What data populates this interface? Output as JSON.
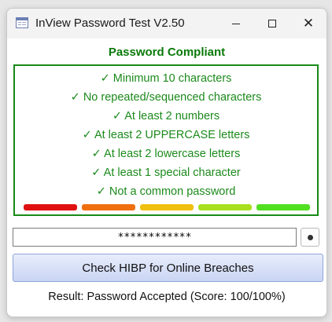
{
  "window": {
    "title": "InView Password Test V2.50",
    "controls": {
      "minimize": "minimize-icon",
      "maximize": "maximize-icon",
      "close": "close-icon"
    }
  },
  "status": {
    "heading": "Password Compliant",
    "color": "#0a7a0a"
  },
  "checks": [
    "✓ Minimum 10 characters",
    "✓ No repeated/sequenced characters",
    "✓ At least 2 numbers",
    "✓ At least 2 UPPERCASE letters",
    "✓ At least 2 lowercase letters",
    "✓ At least 1 special character",
    "✓ Not a common password"
  ],
  "strength_meter": {
    "segments": [
      "#e01010",
      "#f07010",
      "#f0c010",
      "#a8e020",
      "#50e020"
    ]
  },
  "password": {
    "value": "************"
  },
  "reveal_button": {
    "icon": "eye-dot-icon"
  },
  "hibp_button": {
    "label": "Check HIBP for Online Breaches"
  },
  "result": {
    "text": "Result: Password Accepted (Score: 100/100%)"
  }
}
